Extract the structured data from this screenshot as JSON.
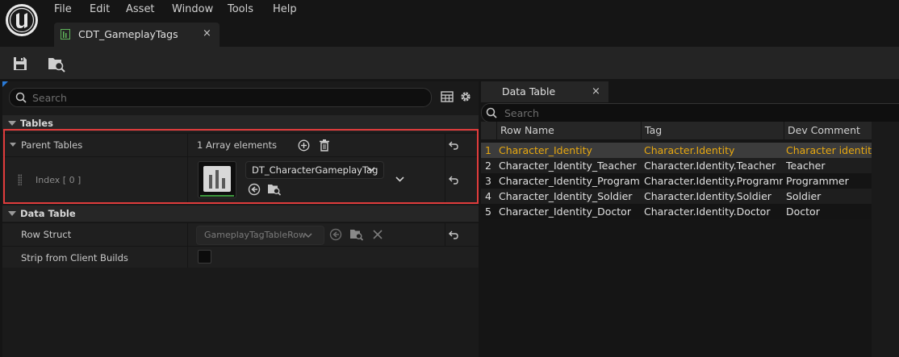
{
  "menu": [
    "File",
    "Edit",
    "Asset",
    "Window",
    "Tools",
    "Help"
  ],
  "tab": {
    "label": "CDT_GameplayTags",
    "close": "×"
  },
  "details": {
    "search_placeholder": "Search",
    "tables_section": "Tables",
    "parent_tables": {
      "label": "Parent Tables",
      "array_count": "1 Array elements"
    },
    "index": {
      "label": "Index [ 0 ]",
      "asset": "DT_CharacterGameplayTag"
    },
    "data_table_section": "Data Table",
    "row_struct": {
      "label": "Row Struct",
      "value": "GameplayTagTableRow"
    },
    "strip": {
      "label": "Strip from Client Builds",
      "checked": false
    }
  },
  "data_table": {
    "tab_label": "Data Table",
    "tab_close": "×",
    "search_placeholder": "Search",
    "columns": [
      "Row Name",
      "Tag",
      "Dev Comment"
    ],
    "rows": [
      {
        "num": "1",
        "name": "Character_Identity",
        "tag": "Character.Identity",
        "comment": "Character identity",
        "selected": true
      },
      {
        "num": "2",
        "name": "Character_Identity_Teacher",
        "tag": "Character.Identity.Teacher",
        "comment": "Teacher"
      },
      {
        "num": "3",
        "name": "Character_Identity_Programm",
        "tag": "Character.Identity.Programmer",
        "comment": "Programmer"
      },
      {
        "num": "4",
        "name": "Character_Identity_Soldier",
        "tag": "Character.Identity.Soldier",
        "comment": "Soldier"
      },
      {
        "num": "5",
        "name": "Character_Identity_Doctor",
        "tag": "Character.Identity.Doctor",
        "comment": "Doctor"
      }
    ]
  },
  "colors": {
    "highlight": "#e03c3c",
    "selected_text": "#e8a810",
    "accent": "#2a7bd8"
  }
}
